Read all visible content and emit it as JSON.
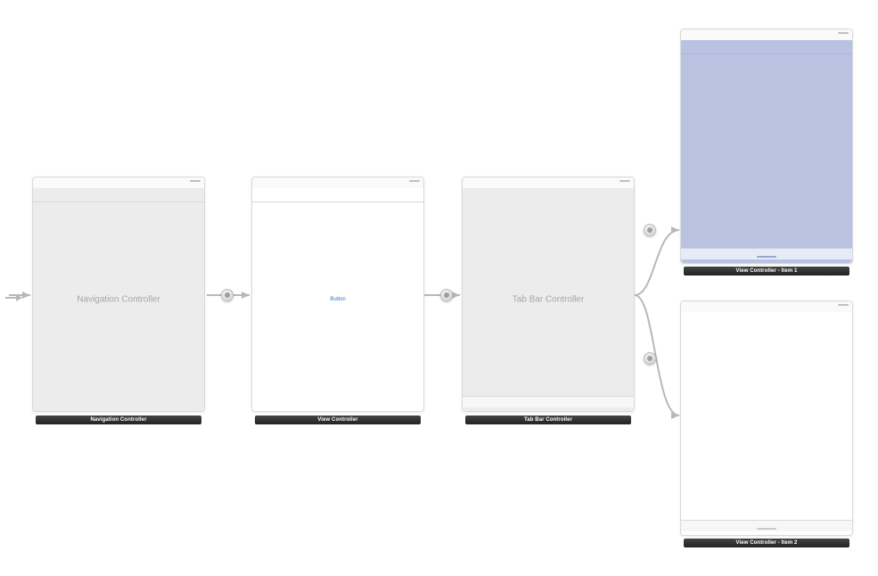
{
  "scenes": {
    "nav": {
      "title": "Navigation Controller",
      "placeholder": "Navigation Controller"
    },
    "vc": {
      "title": "View Controller",
      "button": "Button"
    },
    "tab": {
      "title": "Tab Bar Controller",
      "placeholder": "Tab Bar Controller"
    },
    "item1": {
      "title": "View Controller - Item 1"
    },
    "item2": {
      "title": "View Controller - Item 2"
    }
  }
}
